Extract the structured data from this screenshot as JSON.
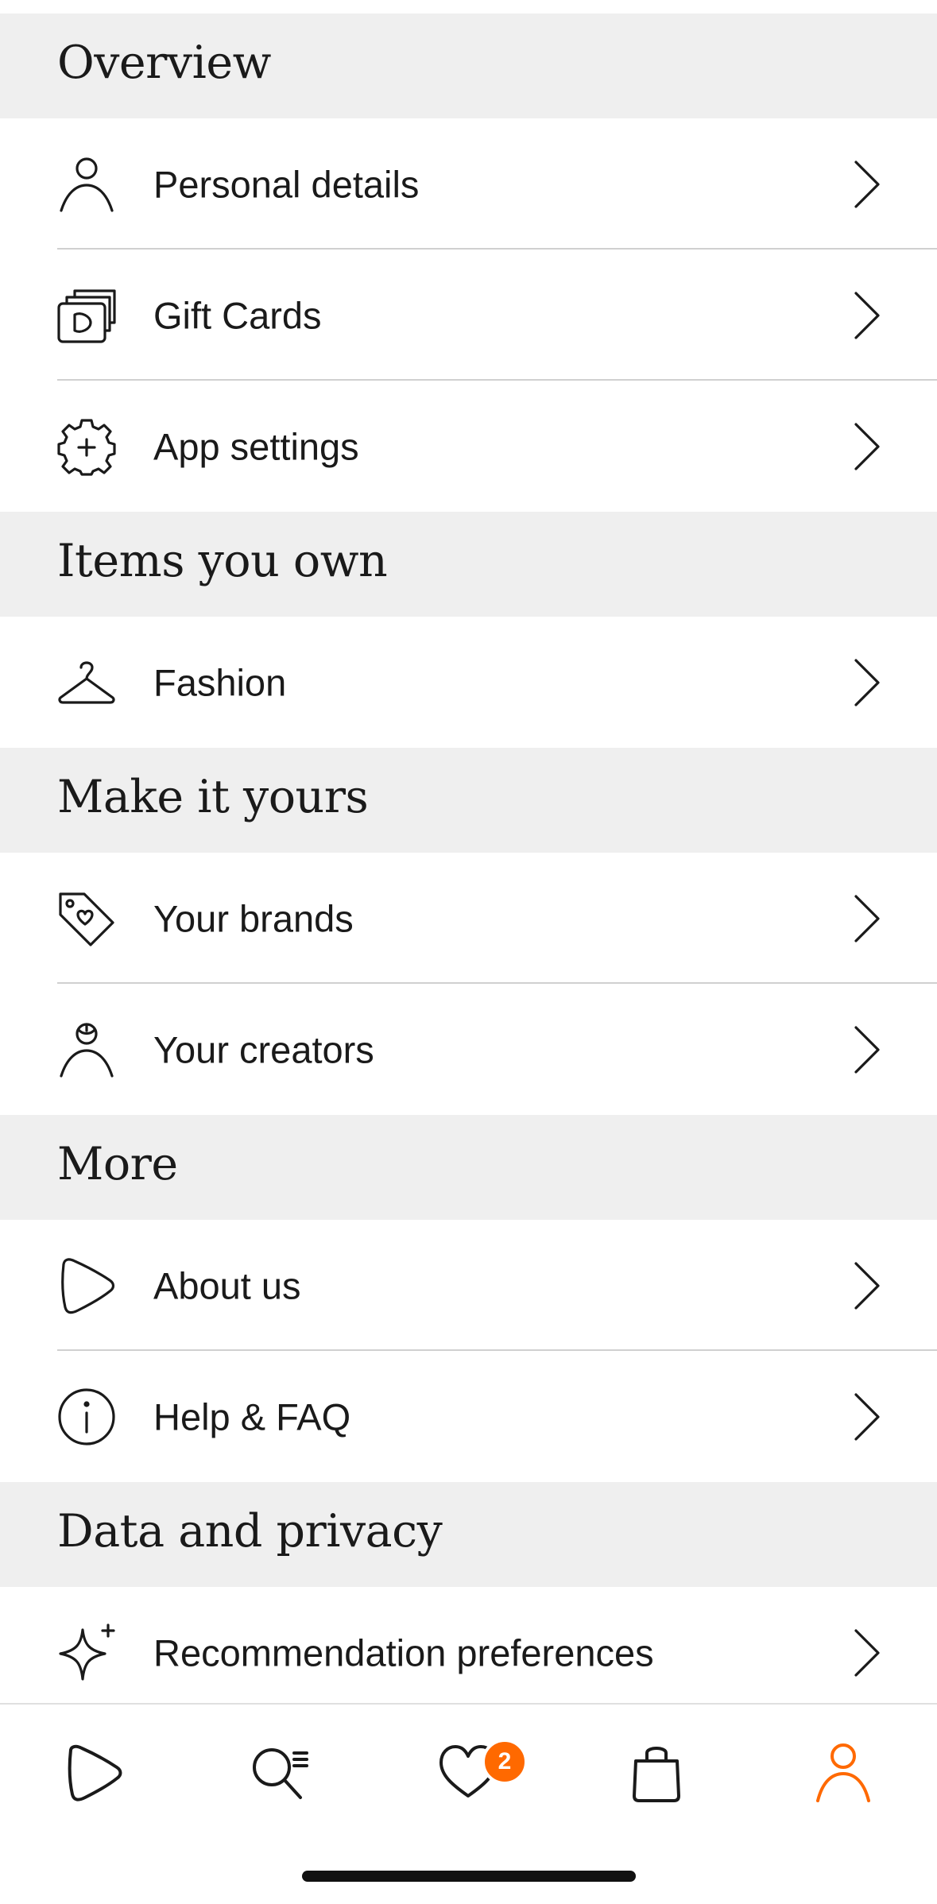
{
  "colors": {
    "accent": "#ff6900",
    "section_bg": "#efefef",
    "divider": "#d0d0d0",
    "text": "#1a1a1a"
  },
  "sections": [
    {
      "title": "Overview",
      "items": [
        {
          "label": "Personal details",
          "icon": "person-icon"
        },
        {
          "label": "Gift Cards",
          "icon": "gift-card-icon"
        },
        {
          "label": "App settings",
          "icon": "gear-icon"
        }
      ]
    },
    {
      "title": "Items you own",
      "items": [
        {
          "label": "Fashion",
          "icon": "hanger-icon"
        }
      ]
    },
    {
      "title": "Make it yours",
      "items": [
        {
          "label": "Your brands",
          "icon": "tag-heart-icon"
        },
        {
          "label": "Your creators",
          "icon": "creator-icon"
        }
      ]
    },
    {
      "title": "More",
      "items": [
        {
          "label": "About us",
          "icon": "zalando-logo-icon"
        },
        {
          "label": "Help & FAQ",
          "icon": "info-icon"
        }
      ]
    },
    {
      "title": "Data and privacy",
      "items": [
        {
          "label": "Recommendation preferences",
          "icon": "sparkle-icon"
        }
      ]
    }
  ],
  "tabbar": {
    "tabs": [
      {
        "name": "home",
        "icon": "zalando-logo-icon"
      },
      {
        "name": "search",
        "icon": "search-icon"
      },
      {
        "name": "wishlist",
        "icon": "heart-icon"
      },
      {
        "name": "bag",
        "icon": "shopping-bag-icon"
      },
      {
        "name": "profile",
        "icon": "person-icon",
        "active": true
      }
    ],
    "wishlist_badge": "2"
  }
}
